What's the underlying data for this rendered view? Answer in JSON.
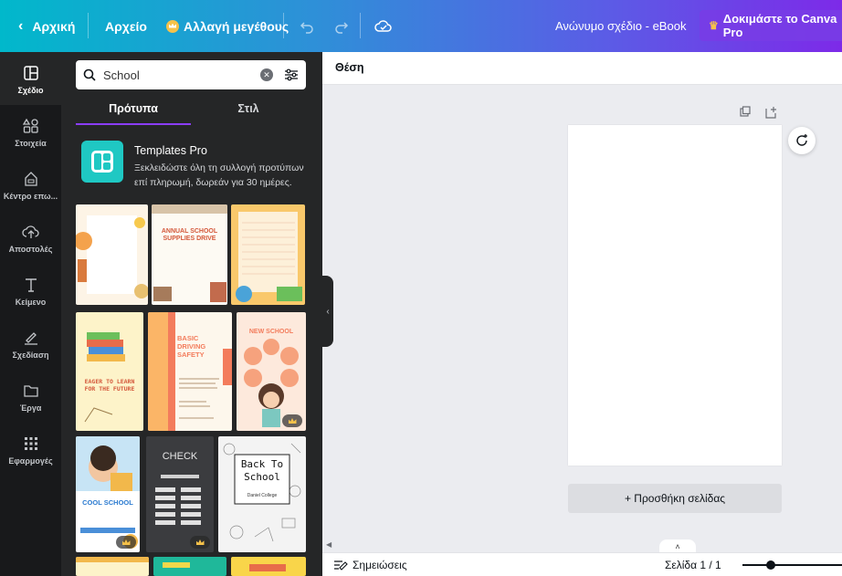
{
  "topbar": {
    "home": "Αρχική",
    "file": "Αρχείο",
    "resize": "Αλλαγή μεγέθους",
    "doc_title": "Ανώνυμο σχέδιο - eBook",
    "try_pro": "Δοκιμάστε το Canva Pro"
  },
  "rail": {
    "items": [
      {
        "label": "Σχέδιο",
        "icon": "layout-icon"
      },
      {
        "label": "Στοιχεία",
        "icon": "shapes-icon"
      },
      {
        "label": "Κέντρο επω...",
        "icon": "brand-icon"
      },
      {
        "label": "Αποστολές",
        "icon": "upload-cloud-icon"
      },
      {
        "label": "Κείμενο",
        "icon": "text-icon"
      },
      {
        "label": "Σχεδίαση",
        "icon": "draw-icon"
      },
      {
        "label": "Έργα",
        "icon": "folder-icon"
      },
      {
        "label": "Εφαρμογές",
        "icon": "apps-grid-icon"
      }
    ]
  },
  "panel": {
    "search_value": "School",
    "tabs": [
      "Πρότυπα",
      "Στιλ"
    ],
    "pro_title": "Templates Pro",
    "pro_desc": "Ξεκλειδώστε όλη τη συλλογή προτύπων επί πληρωμή, δωρεάν για 30 ημέρες.",
    "templates": [
      {
        "text": "",
        "bg": "#fbe9d7"
      },
      {
        "text": "ANNUAL SCHOOL SUPPLIES DRIVE",
        "bg": "#fdfaf3"
      },
      {
        "text": "",
        "bg": "#fdf0d9"
      },
      {
        "text": "EAGER TO LEARN FOR THE FUTURE",
        "bg": "#fdf3c9"
      },
      {
        "text": "BASIC DRIVING SAFETY",
        "bg": "#fdf7ec"
      },
      {
        "text": "NEW SCHOOL",
        "bg": "#fde9dc"
      },
      {
        "text": "COOL SCHOOL",
        "bg": "#ffffff"
      },
      {
        "text": "CHECK",
        "bg": "#3b3c3f"
      },
      {
        "text": "Back To School",
        "bg": "#f3f3f3"
      }
    ],
    "template_subtitle": "Daniel College"
  },
  "editor": {
    "position_label": "Θέση",
    "add_page": "+ Προσθήκη σελίδας",
    "notes": "Σημειώσεις",
    "page_counter": "Σελίδα 1 / 1"
  }
}
